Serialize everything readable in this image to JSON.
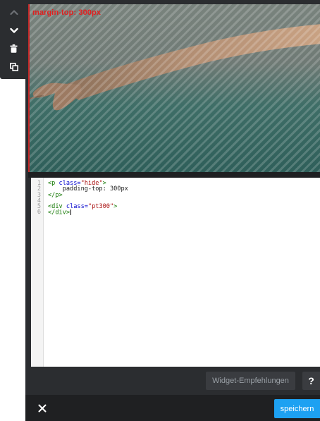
{
  "toolbar": {
    "icons": [
      "chevron-up-icon",
      "chevron-down-icon",
      "trash-icon",
      "copy-icon"
    ]
  },
  "preview": {
    "margin_label": "margin-top: 300px"
  },
  "editor": {
    "line_numbers": [
      "1",
      "2",
      "3",
      "4",
      "5",
      "6"
    ],
    "lines": {
      "l1_tag_open": "<p ",
      "l1_attr": "class=",
      "l1_str": "\"hide\"",
      "l1_tag_close": ">",
      "l2_text": "    padding-top: 300px",
      "l3_tag": "</p>",
      "l5_tag_open": "<div ",
      "l5_attr": "class=",
      "l5_str": "\"pt300\"",
      "l5_tag_close": ">",
      "l6_tag": "</div>"
    }
  },
  "buttons": {
    "recommendations": "Widget-Empfehlungen",
    "help": "?",
    "save": "speichern"
  },
  "colors": {
    "frame": "#2b2d30",
    "footer": "#1f2022",
    "save": "#1da1f2",
    "margin_label": "#e02020"
  }
}
